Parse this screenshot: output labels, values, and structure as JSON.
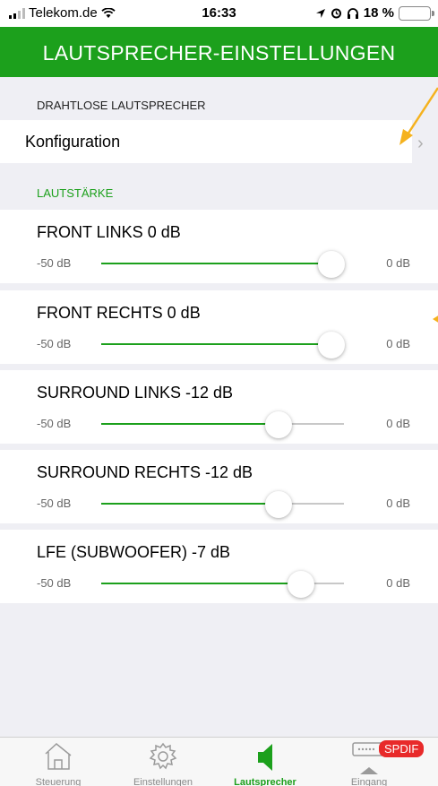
{
  "status": {
    "carrier": "Telekom.de",
    "time": "16:33",
    "battery": "18 %",
    "battery_level": 0.18
  },
  "header": {
    "title": "LAUTSPRECHER-EINSTELLUNGEN"
  },
  "wireless": {
    "section_label": "DRAHTLOSE LAUTSPRECHER",
    "config_label": "Konfiguration"
  },
  "volume": {
    "section_label": "LAUTSTÄRKE",
    "min_label": "-50 dB",
    "max_label": "0 dB",
    "min": -50,
    "max": 0,
    "channels": [
      {
        "name": "FRONT LINKS  0 dB",
        "value": 0
      },
      {
        "name": "FRONT RECHTS  0 dB",
        "value": 0
      },
      {
        "name": "SURROUND LINKS  -12 dB",
        "value": -12
      },
      {
        "name": "SURROUND RECHTS  -12 dB",
        "value": -12
      },
      {
        "name": "LFE (SUBWOOFER)  -7 dB",
        "value": -7
      }
    ]
  },
  "tabs": [
    {
      "label": "Steuerung",
      "icon": "house-icon"
    },
    {
      "label": "Einstellungen",
      "icon": "gear-icon"
    },
    {
      "label": "Lautsprecher",
      "icon": "speaker-icon",
      "active": true
    },
    {
      "label": "Eingang",
      "icon": "input-icon"
    }
  ],
  "input_badge": "SPDIF",
  "colors": {
    "accent": "#1ca01c",
    "annotation_arrow": "#f5b21e",
    "badge": "#e82a2a"
  }
}
